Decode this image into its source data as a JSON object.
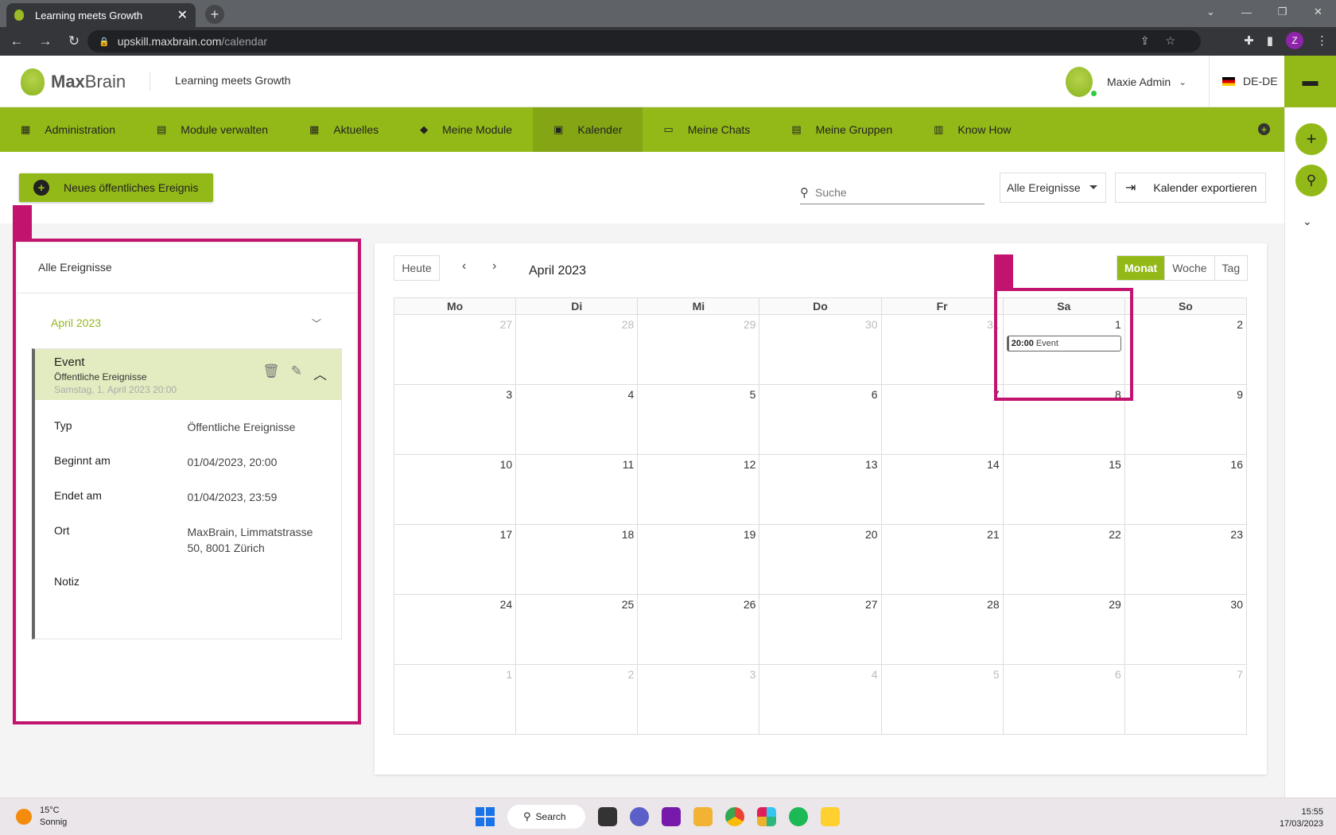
{
  "browser": {
    "tab_title": "Learning meets Growth",
    "url_host": "upskill.maxbrain.com",
    "url_path": "/calendar",
    "profile_initial": "Z"
  },
  "header": {
    "logo_text_bold": "Max",
    "logo_text_regular": "Brain",
    "tagline": "Learning meets Growth",
    "user_name": "Maxie Admin",
    "language": "DE-DE"
  },
  "nav": {
    "items": [
      {
        "label": "Administration",
        "icon": "grid-icon"
      },
      {
        "label": "Module verwalten",
        "icon": "folder-icon"
      },
      {
        "label": "Aktuelles",
        "icon": "grid-icon"
      },
      {
        "label": "Meine Module",
        "icon": "graduation-cap-icon"
      },
      {
        "label": "Kalender",
        "icon": "calendar-icon"
      },
      {
        "label": "Meine Chats",
        "icon": "laptop-icon"
      },
      {
        "label": "Meine Gruppen",
        "icon": "folder-icon"
      },
      {
        "label": "Know How",
        "icon": "book-icon"
      }
    ],
    "active": "Kalender"
  },
  "toolbar": {
    "new_event_label": "Neues öffentliches Ereignis",
    "search_placeholder": "Suche",
    "filter_value": "Alle Ereignisse",
    "export_label": "Kalender exportieren"
  },
  "sidebar": {
    "title": "Alle Ereignisse",
    "month": "April 2023",
    "event": {
      "title": "Event",
      "type_line": "Öffentliche Ereignisse",
      "date_line": "Samstag, 1. April 2023 20:00",
      "details": [
        {
          "label": "Typ",
          "value": "Öffentliche Ereignisse"
        },
        {
          "label": "Beginnt am",
          "value": "01/04/2023, 20:00"
        },
        {
          "label": "Endet am",
          "value": "01/04/2023, 23:59"
        },
        {
          "label": "Ort",
          "value": "MaxBrain, Limmatstrasse 50, 8001 Zürich"
        },
        {
          "label": "Notiz",
          "value": ""
        }
      ]
    }
  },
  "calendar": {
    "today_label": "Heute",
    "title": "April 2023",
    "views": [
      "Monat",
      "Woche",
      "Tag"
    ],
    "active_view": "Monat",
    "weekdays": [
      "Mo",
      "Di",
      "Mi",
      "Do",
      "Fr",
      "Sa",
      "So"
    ],
    "weeks": [
      [
        {
          "d": "27",
          "o": true
        },
        {
          "d": "28",
          "o": true
        },
        {
          "d": "29",
          "o": true
        },
        {
          "d": "30",
          "o": true
        },
        {
          "d": "31",
          "o": true
        },
        {
          "d": "1",
          "o": false
        },
        {
          "d": "2",
          "o": false
        }
      ],
      [
        {
          "d": "3",
          "o": false
        },
        {
          "d": "4",
          "o": false
        },
        {
          "d": "5",
          "o": false
        },
        {
          "d": "6",
          "o": false
        },
        {
          "d": "7",
          "o": false
        },
        {
          "d": "8",
          "o": false
        },
        {
          "d": "9",
          "o": false
        }
      ],
      [
        {
          "d": "10",
          "o": false
        },
        {
          "d": "11",
          "o": false
        },
        {
          "d": "12",
          "o": false
        },
        {
          "d": "13",
          "o": false
        },
        {
          "d": "14",
          "o": false
        },
        {
          "d": "15",
          "o": false
        },
        {
          "d": "16",
          "o": false
        }
      ],
      [
        {
          "d": "17",
          "o": false
        },
        {
          "d": "18",
          "o": false
        },
        {
          "d": "19",
          "o": false
        },
        {
          "d": "20",
          "o": false
        },
        {
          "d": "21",
          "o": false
        },
        {
          "d": "22",
          "o": false
        },
        {
          "d": "23",
          "o": false
        }
      ],
      [
        {
          "d": "24",
          "o": false
        },
        {
          "d": "25",
          "o": false
        },
        {
          "d": "26",
          "o": false
        },
        {
          "d": "27",
          "o": false
        },
        {
          "d": "28",
          "o": false
        },
        {
          "d": "29",
          "o": false
        },
        {
          "d": "30",
          "o": false
        }
      ],
      [
        {
          "d": "1",
          "o": true
        },
        {
          "d": "2",
          "o": true
        },
        {
          "d": "3",
          "o": true
        },
        {
          "d": "4",
          "o": true
        },
        {
          "d": "5",
          "o": true
        },
        {
          "d": "6",
          "o": true
        },
        {
          "d": "7",
          "o": true
        }
      ]
    ],
    "event_chip": {
      "time": "20:00",
      "title": "Event",
      "week": 0,
      "day": 5
    }
  },
  "taskbar": {
    "temperature": "15°C",
    "weather": "Sonnig",
    "search_label": "Search",
    "time": "15:55",
    "date": "17/03/2023"
  },
  "colors": {
    "brand_green": "#93b918",
    "highlight": "#c2136e"
  }
}
